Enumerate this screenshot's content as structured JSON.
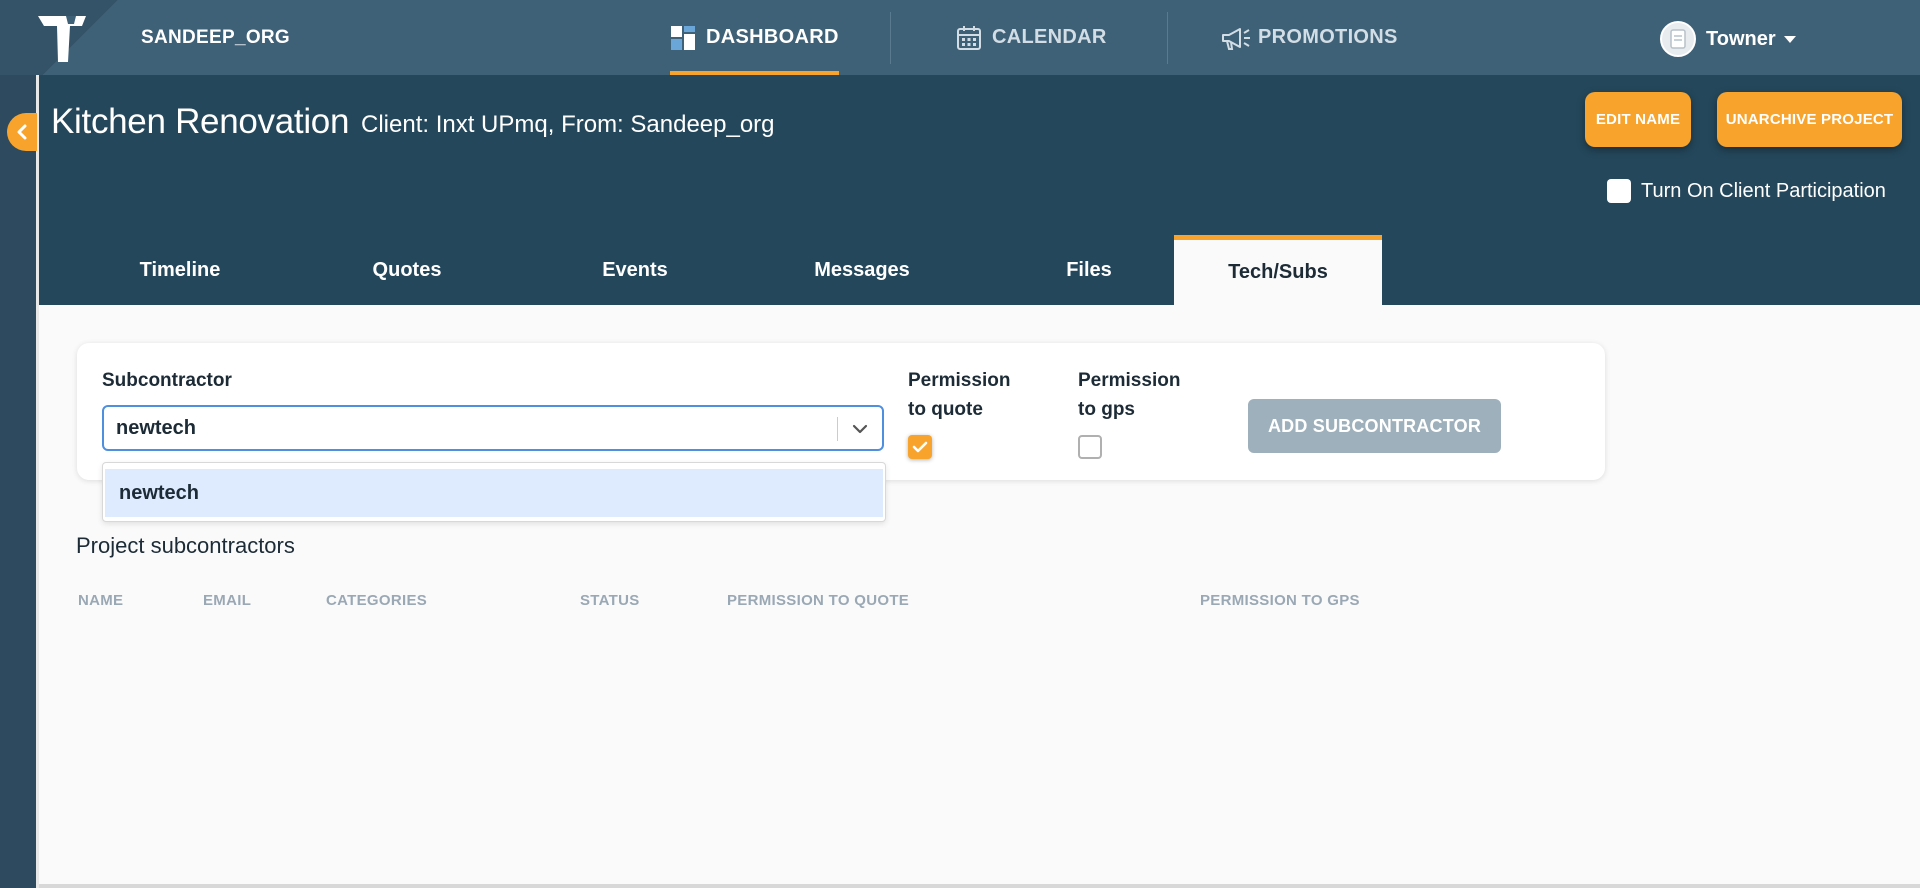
{
  "topbar": {
    "org": "SANDEEP_ORG",
    "nav": [
      {
        "label": "DASHBOARD",
        "icon": "dashboard-icon",
        "active": true
      },
      {
        "label": "CALENDAR",
        "icon": "calendar-icon",
        "active": false
      },
      {
        "label": "PROMOTIONS",
        "icon": "megaphone-icon",
        "active": false
      }
    ],
    "user": "Towner"
  },
  "project": {
    "title": "Kitchen Renovation",
    "subtitle": "Client: Inxt UPmq, From: Sandeep_org",
    "edit_label": "EDIT NAME",
    "unarchive_label": "UNARCHIVE PROJECT",
    "client_participation_label": "Turn On Client Participation"
  },
  "tabs": [
    "Timeline",
    "Quotes",
    "Events",
    "Messages",
    "Files",
    "Tech/Subs"
  ],
  "active_tab": "Tech/Subs",
  "form": {
    "subcontractor_label": "Subcontractor",
    "subcontractor_value": "newtech",
    "perm_quote_label_1": "Permission",
    "perm_quote_label_2": "to quote",
    "perm_quote_checked": true,
    "perm_gps_label_1": "Permission",
    "perm_gps_label_2": "to gps",
    "perm_gps_checked": false,
    "add_label": "ADD SUBCONTRACTOR",
    "dropdown_option": "newtech"
  },
  "subs": {
    "title": "Project subcontractors",
    "columns": [
      "NAME",
      "EMAIL",
      "CATEGORIES",
      "STATUS",
      "PERMISSION TO QUOTE",
      "PERMISSION TO GPS"
    ]
  },
  "colors": {
    "accent": "#f7a32c",
    "nav_bg": "#3f6178",
    "header_bg": "#24475b"
  }
}
